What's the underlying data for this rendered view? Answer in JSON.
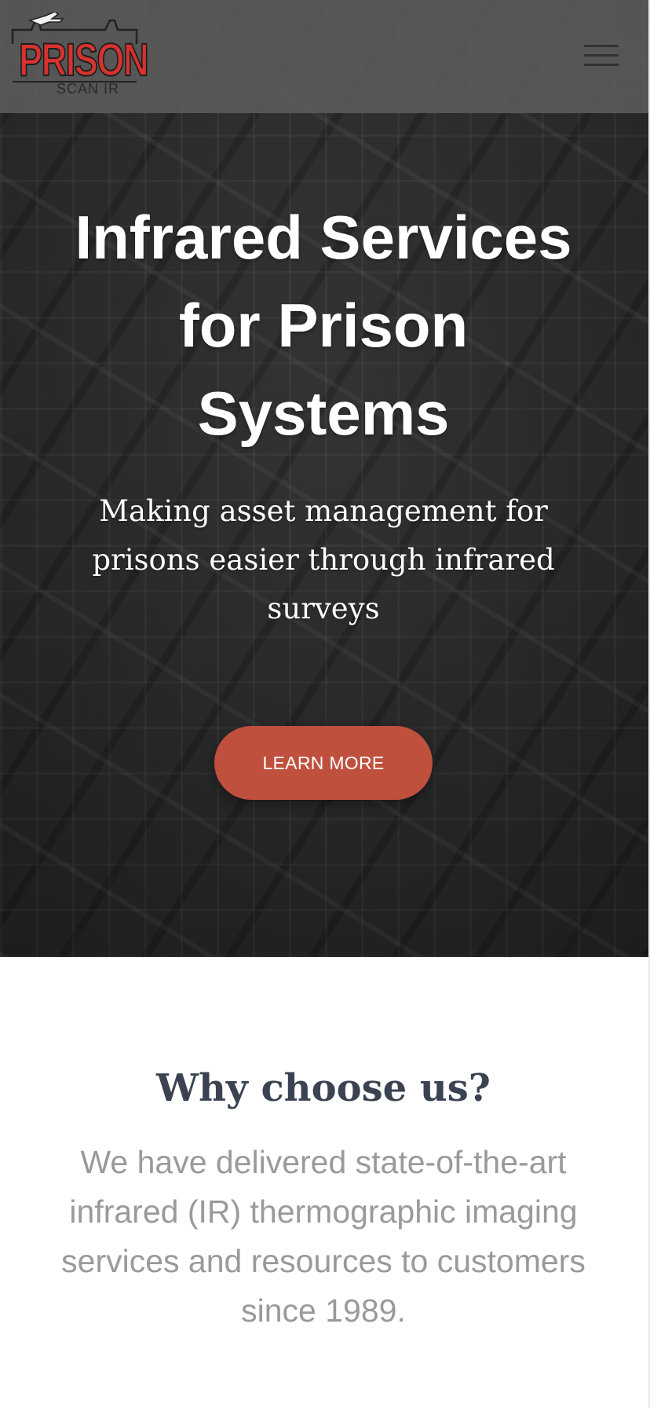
{
  "header": {
    "logo": {
      "word": "PRISON",
      "sub": "SCAN IR"
    },
    "menu_icon": "hamburger-menu-icon"
  },
  "hero": {
    "title": "Infrared Services for Prison Systems",
    "subtitle": "Making asset management for prisons easier through infrared surveys",
    "cta_label": "LEARN MORE"
  },
  "why": {
    "title": "Why choose us?",
    "text": "We have delivered state-of-the-art infrared (IR) thermographic imaging services and resources to customers since 1989."
  },
  "colors": {
    "accent": "#c0503e",
    "logo_red": "#d8322f",
    "heading_dark": "#3b4352",
    "body_gray": "#9a9a9a"
  }
}
